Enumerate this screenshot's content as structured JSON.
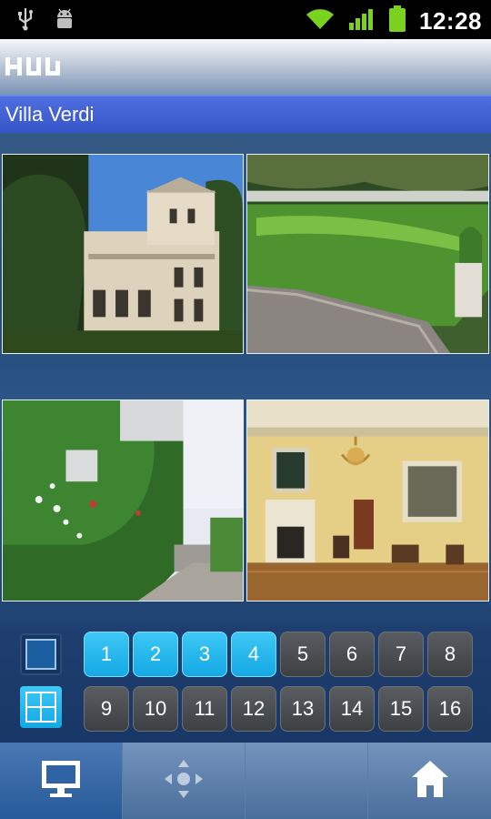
{
  "status_bar": {
    "time": "12:28",
    "icons": [
      "usb-icon",
      "android-debug-icon",
      "wifi-icon",
      "signal-icon",
      "battery-icon"
    ]
  },
  "app": {
    "logo_icon": "hw-logo-icon"
  },
  "site": {
    "title": "Villa Verdi"
  },
  "cameras": [
    {
      "name": "villa-exterior"
    },
    {
      "name": "garden-lawn"
    },
    {
      "name": "ivy-wall-steps"
    },
    {
      "name": "ballroom-interior"
    }
  ],
  "layout_buttons": [
    {
      "icon": "single-view-icon",
      "selected": false
    },
    {
      "icon": "quad-view-icon",
      "selected": true
    }
  ],
  "channels": [
    {
      "label": "1",
      "active": true
    },
    {
      "label": "2",
      "active": true
    },
    {
      "label": "3",
      "active": true
    },
    {
      "label": "4",
      "active": true
    },
    {
      "label": "5",
      "active": false
    },
    {
      "label": "6",
      "active": false
    },
    {
      "label": "7",
      "active": false
    },
    {
      "label": "8",
      "active": false
    },
    {
      "label": "9",
      "active": false
    },
    {
      "label": "10",
      "active": false
    },
    {
      "label": "11",
      "active": false
    },
    {
      "label": "12",
      "active": false
    },
    {
      "label": "13",
      "active": false
    },
    {
      "label": "14",
      "active": false
    },
    {
      "label": "15",
      "active": false
    },
    {
      "label": "16",
      "active": false
    }
  ],
  "bottom_nav": [
    {
      "icon": "monitor-icon",
      "active": true
    },
    {
      "icon": "ptz-dpad-icon",
      "active": false
    },
    {
      "icon": "blank",
      "active": false
    },
    {
      "icon": "home-icon",
      "active": false
    }
  ],
  "colors": {
    "title_bar": "#3f60d4",
    "channel_active": "#22b4ee",
    "channel_inactive": "#47494c"
  }
}
